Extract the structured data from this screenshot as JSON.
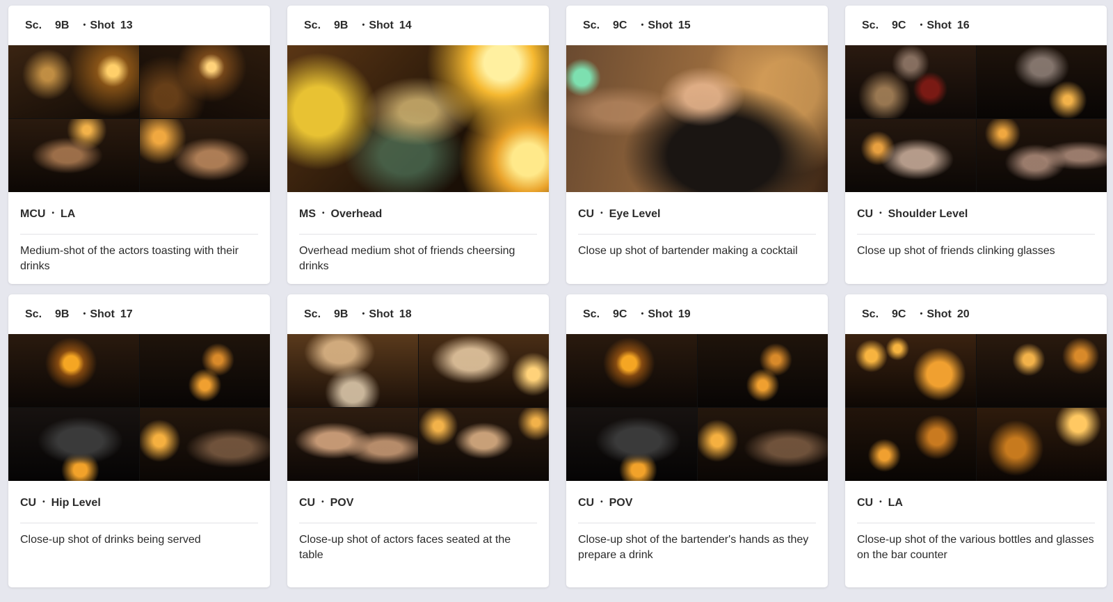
{
  "sc_label": "Sc.",
  "shot_label": "Shot",
  "cards": [
    {
      "scene": "9B",
      "shot": "13",
      "size": "MCU",
      "angle": "LA",
      "description": "Medium-shot of the actors toasting with their drinks"
    },
    {
      "scene": "9B",
      "shot": "14",
      "size": "MS",
      "angle": "Overhead",
      "description": "Overhead medium shot of friends cheersing drinks"
    },
    {
      "scene": "9C",
      "shot": "15",
      "size": "CU",
      "angle": "Eye Level",
      "description": "Close up shot of bartender making a cocktail"
    },
    {
      "scene": "9C",
      "shot": "16",
      "size": "CU",
      "angle": "Shoulder Level",
      "description": "Close up shot of friends clinking glasses"
    },
    {
      "scene": "9B",
      "shot": "17",
      "size": "CU",
      "angle": "Hip Level",
      "description": "Close-up shot of drinks being served"
    },
    {
      "scene": "9B",
      "shot": "18",
      "size": "CU",
      "angle": "POV",
      "description": "Close-up shot of actors faces seated at the table"
    },
    {
      "scene": "9C",
      "shot": "19",
      "size": "CU",
      "angle": "POV",
      "description": "Close-up shot of the bartender's hands as they prepare a drink"
    },
    {
      "scene": "9C",
      "shot": "20",
      "size": "CU",
      "angle": "LA",
      "description": "Close-up shot of the various bottles and glasses on the bar counter"
    }
  ],
  "thumbnail_colors": {
    "dark": "#1a120b",
    "warm": "#c77a1e",
    "glow": "#ffcf6a"
  }
}
